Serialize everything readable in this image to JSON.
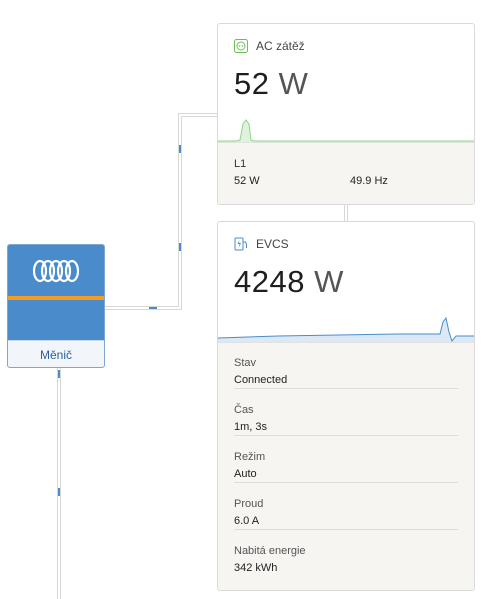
{
  "inverter": {
    "label": "Měnič",
    "logo_icon": "victron-logo-icon"
  },
  "ac_load": {
    "title": "AC zátěž",
    "icon": "socket-icon",
    "value": "52",
    "unit": "W",
    "phase_label": "L1",
    "phase_power": "52 W",
    "frequency": "49.9 Hz"
  },
  "evcs": {
    "title": "EVCS",
    "icon": "ev-charger-icon",
    "value": "4248",
    "unit": "W",
    "rows": [
      {
        "key": "Stav",
        "value": "Connected"
      },
      {
        "key": "Čas",
        "value": "1m, 3s"
      },
      {
        "key": "Režim",
        "value": "Auto"
      },
      {
        "key": "Proud",
        "value": "6.0 A"
      },
      {
        "key": "Nabitá energie",
        "value": "342 kWh"
      }
    ]
  },
  "colors": {
    "inverter_blue": "#4a8ccb",
    "inverter_stripe": "#f39c1f",
    "ac_spark": "#8fd48a",
    "evcs_spark": "#4a8ccb",
    "wire": "#d8d8d8",
    "wire_dot": "#4a8ccb"
  }
}
